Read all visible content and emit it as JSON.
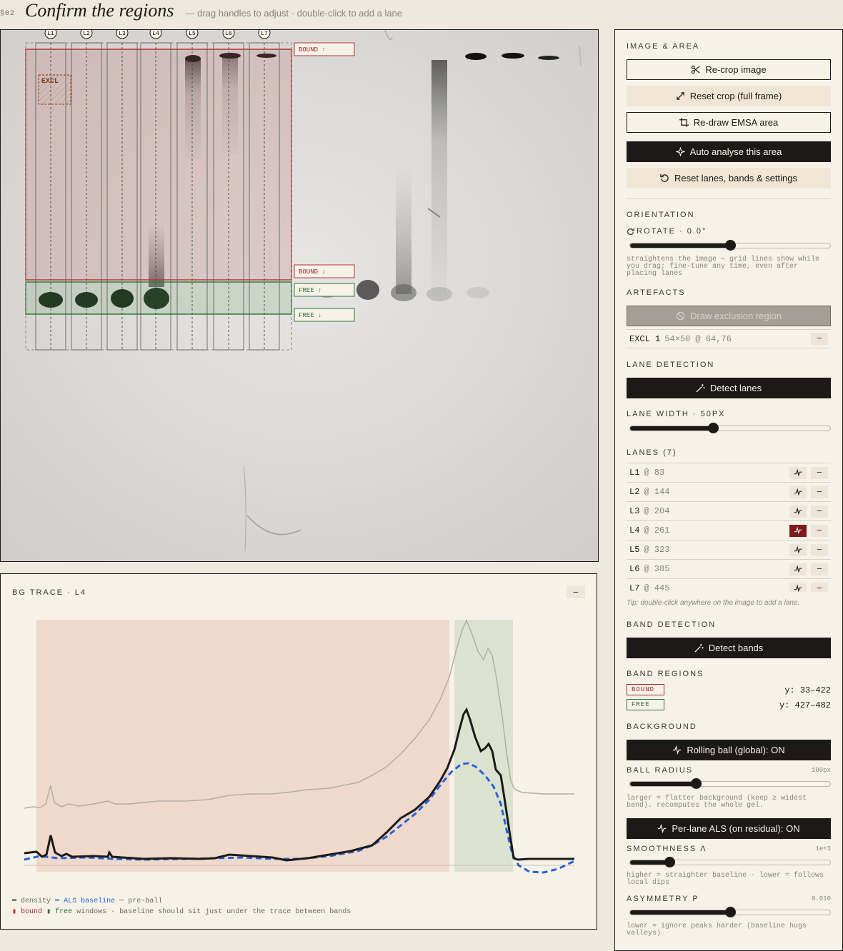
{
  "header": {
    "section": "§02",
    "title": "Confirm the regions",
    "subtitle": "— drag handles to adjust · double-click to add a lane"
  },
  "gel": {
    "lane_labels": [
      "L1",
      "L2",
      "L3",
      "L4",
      "L5",
      "L6",
      "L7"
    ],
    "bound_top_label": "BOUND ↑",
    "bound_bottom_label": "BOUND ↓",
    "free_top_label": "FREE ↑",
    "free_bottom_label": "FREE ↓",
    "exclusion_label": "EXCL"
  },
  "trace": {
    "title": "BG TRACE · L4",
    "collapse_label": "−",
    "legend_line1": {
      "density": "density",
      "baseline": "ALS baseline",
      "preball": "pre-ball"
    },
    "legend_line2": {
      "bound": "bound",
      "free": "free",
      "rest": "windows · baseline should sit just under the trace between bands"
    },
    "colors": {
      "density": "#1c1a17",
      "baseline": "#2563d8",
      "preball": "#b3ada3",
      "bound": "#efd8cc",
      "free": "#dbe3d0"
    }
  },
  "sidebar": {
    "image_area": {
      "heading": "IMAGE & AREA",
      "recrop": "Re-crop image",
      "reset_crop": "Reset crop (full frame)",
      "redraw": "Re-draw EMSA area",
      "auto": "Auto analyse this area",
      "reset_all": "Reset lanes, bands & settings"
    },
    "orientation": {
      "heading": "ORIENTATION",
      "rotate_label": "ROTATE · 0.0°",
      "rotate_fraction": 0.5,
      "note": "straightens the image — grid lines show while you drag; fine-tune any time, even after placing lanes"
    },
    "artefacts": {
      "heading": "ARTEFACTS",
      "draw_button": "Draw exclusion region",
      "item_name": "EXCL 1",
      "item_detail": "54×50 @ 64,76",
      "item_remove": "−"
    },
    "lane_detection": {
      "heading": "LANE DETECTION",
      "detect_button": "Detect lanes",
      "width_label": "LANE WIDTH · 50PX",
      "width_fraction": 0.41
    },
    "lanes": {
      "heading": "LANES (7)",
      "items": [
        {
          "label": "L1",
          "pos": "@ 83",
          "active": false
        },
        {
          "label": "L2",
          "pos": "@ 144",
          "active": false
        },
        {
          "label": "L3",
          "pos": "@ 204",
          "active": false
        },
        {
          "label": "L4",
          "pos": "@ 261",
          "active": true
        },
        {
          "label": "L5",
          "pos": "@ 323",
          "active": false
        },
        {
          "label": "L6",
          "pos": "@ 385",
          "active": false
        },
        {
          "label": "L7",
          "pos": "@ 445",
          "active": false
        }
      ],
      "remove": "−",
      "tip": "Tip: double-click anywhere on the image to add a lane."
    },
    "band_detection": {
      "heading": "BAND DETECTION",
      "detect_button": "Detect bands"
    },
    "band_regions": {
      "heading": "BAND REGIONS",
      "bound_badge": "BOUND",
      "bound_range": "y: 33–422",
      "free_badge": "FREE",
      "free_range": "y: 427–482",
      "bound_color": "#9b2a2a",
      "free_color": "#2d6e36"
    },
    "background": {
      "heading": "BACKGROUND",
      "rolling_button": "Rolling ball (global): ON",
      "radius_label": "BALL RADIUS",
      "radius_value": "100px",
      "radius_fraction": 0.32,
      "radius_note": "larger = flatter background (keep ≥ widest band). recomputes the whole gel.",
      "als_button": "Per-lane ALS (on residual): ON",
      "smooth_label": "SMOOTHNESS Λ",
      "smooth_value": "1e+3",
      "smooth_fraction": 0.18,
      "smooth_note": "higher = straighter baseline · lower = follows local dips",
      "asym_label": "ASYMMETRY P",
      "asym_value": "0.010",
      "asym_fraction": 0.5,
      "asym_note": "lower = ignore peaks harder (baseline hugs valleys)"
    }
  }
}
